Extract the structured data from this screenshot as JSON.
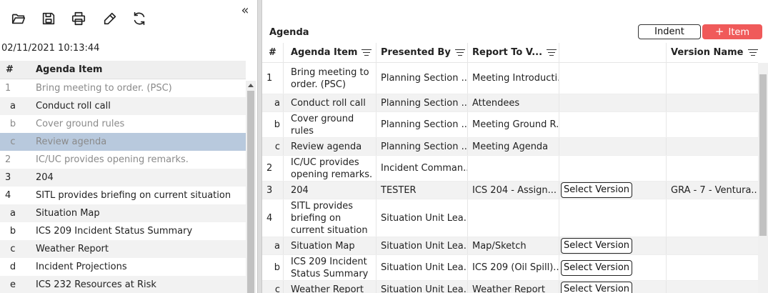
{
  "toolbar": {
    "icons": [
      "folder-open-icon",
      "save-icon",
      "print-icon",
      "edit-icon",
      "refresh-icon"
    ],
    "collapse_glyph": "«"
  },
  "timestamp": "02/11/2021 10:13:44",
  "left_table": {
    "headers": {
      "num": "#",
      "item": "Agenda Item"
    },
    "rows": [
      {
        "num": "1",
        "text": "Bring meeting to order. (PSC)",
        "sub": false,
        "grey": true,
        "alt": false,
        "sel": false
      },
      {
        "num": "a",
        "text": "Conduct roll call",
        "sub": true,
        "grey": false,
        "alt": true,
        "sel": false
      },
      {
        "num": "b",
        "text": "Cover ground rules",
        "sub": true,
        "grey": true,
        "alt": false,
        "sel": false
      },
      {
        "num": "c",
        "text": "Review agenda",
        "sub": true,
        "grey": true,
        "alt": false,
        "sel": true
      },
      {
        "num": "2",
        "text": "IC/UC provides opening remarks.",
        "sub": false,
        "grey": true,
        "alt": false,
        "sel": false
      },
      {
        "num": "3",
        "text": "204",
        "sub": false,
        "grey": false,
        "alt": true,
        "sel": false
      },
      {
        "num": "4",
        "text": "SITL provides briefing on current situation",
        "sub": false,
        "grey": false,
        "alt": false,
        "sel": false
      },
      {
        "num": "a",
        "text": "Situation Map",
        "sub": true,
        "grey": false,
        "alt": true,
        "sel": false
      },
      {
        "num": "b",
        "text": "ICS 209 Incident Status Summary",
        "sub": true,
        "grey": false,
        "alt": false,
        "sel": false
      },
      {
        "num": "c",
        "text": "Weather Report",
        "sub": true,
        "grey": false,
        "alt": true,
        "sel": false
      },
      {
        "num": "d",
        "text": "Incident Projections",
        "sub": true,
        "grey": false,
        "alt": false,
        "sel": false
      },
      {
        "num": "e",
        "text": "ICS 232 Resources at Risk",
        "sub": true,
        "grey": false,
        "alt": true,
        "sel": false
      }
    ]
  },
  "agenda": {
    "title": "Agenda",
    "indent_label": "Indent",
    "item_label": "Item",
    "columns": [
      "#",
      "Agenda Item",
      "Presented By",
      "Report To V...",
      "",
      "Version Name"
    ],
    "rows": [
      {
        "num": "1",
        "sub": false,
        "item": "Bring meeting to order. (PSC)",
        "presenter": "Planning Section ...",
        "report": "Meeting Introducti...",
        "button": "",
        "version": "",
        "height": 44,
        "alt": false
      },
      {
        "num": "a",
        "sub": true,
        "item": "Conduct roll call",
        "presenter": "Planning Section ...",
        "report": "Attendees",
        "button": "",
        "version": "",
        "height": 25,
        "alt": true
      },
      {
        "num": "b",
        "sub": true,
        "item": "Cover ground rules",
        "presenter": "Planning Section ...",
        "report": "Meeting Ground R...",
        "button": "",
        "version": "",
        "height": 36,
        "alt": false
      },
      {
        "num": "c",
        "sub": true,
        "item": "Review agenda",
        "presenter": "Planning Section ...",
        "report": "Meeting Agenda",
        "button": "",
        "version": "",
        "height": 25,
        "alt": true
      },
      {
        "num": "2",
        "sub": false,
        "item": "IC/UC provides opening remarks.",
        "presenter": "Incident Comman...",
        "report": "",
        "button": "",
        "version": "",
        "height": 36,
        "alt": false
      },
      {
        "num": "3",
        "sub": false,
        "item": "204",
        "presenter": "TESTER",
        "report": "ICS 204 - Assign...",
        "button": "Select Version",
        "version": "GRA - 7 - Ventura...",
        "height": 25,
        "alt": true
      },
      {
        "num": "4",
        "sub": false,
        "item": "SITL provides briefing on current situation",
        "presenter": "Situation Unit Lea...",
        "report": "",
        "button": "",
        "version": "",
        "height": 53,
        "alt": false
      },
      {
        "num": "a",
        "sub": true,
        "item": "Situation Map",
        "presenter": "Situation Unit Lea...",
        "report": "Map/Sketch",
        "button": "Select Version",
        "version": "",
        "height": 25,
        "alt": true
      },
      {
        "num": "b",
        "sub": true,
        "item": "ICS 209 Incident Status Summary",
        "presenter": "Situation Unit Lea...",
        "report": "ICS 209 (Oil Spill)...",
        "button": "Select Version",
        "version": "",
        "height": 36,
        "alt": false
      },
      {
        "num": "c",
        "sub": true,
        "item": "Weather Report",
        "presenter": "Situation Unit Lea...",
        "report": "Weather Report",
        "button": "Select Version",
        "version": "",
        "height": 25,
        "alt": true
      }
    ]
  }
}
